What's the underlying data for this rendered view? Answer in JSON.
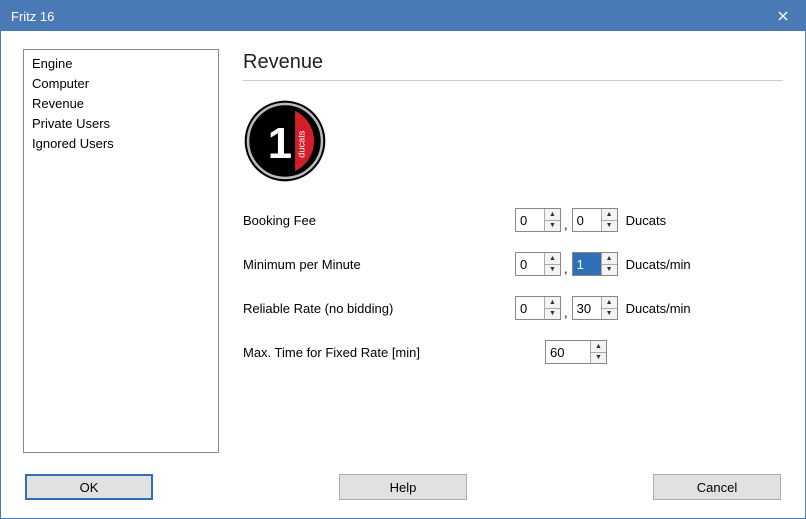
{
  "window": {
    "title": "Fritz 16"
  },
  "sidebar": {
    "items": [
      {
        "label": "Engine"
      },
      {
        "label": "Computer"
      },
      {
        "label": "Revenue"
      },
      {
        "label": "Private Users"
      },
      {
        "label": "Ignored Users"
      }
    ],
    "selected_index": 2
  },
  "main": {
    "heading": "Revenue",
    "logo": {
      "name": "ducats-logo",
      "digit": "1",
      "side_text": "ducats"
    },
    "fields": {
      "booking_fee": {
        "label": "Booking Fee",
        "a": "0",
        "b": "0",
        "unit": "Ducats"
      },
      "min_per_minute": {
        "label": "Minimum per Minute",
        "a": "0",
        "b": "1",
        "unit": "Ducats/min",
        "b_highlighted": true
      },
      "reliable_rate": {
        "label": "Reliable Rate (no bidding)",
        "a": "0",
        "b": "30",
        "unit": "Ducats/min"
      },
      "max_fixed_time": {
        "label": "Max. Time for Fixed Rate [min]",
        "value": "60"
      }
    }
  },
  "buttons": {
    "ok": "OK",
    "help": "Help",
    "cancel": "Cancel"
  }
}
